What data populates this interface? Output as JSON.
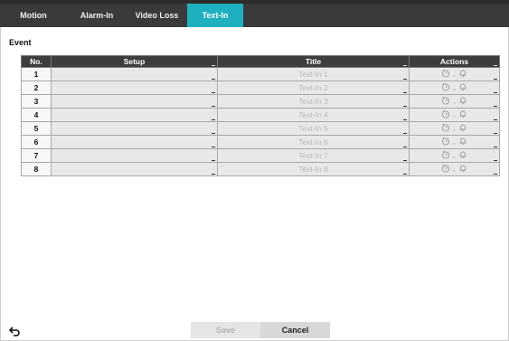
{
  "tabs": [
    {
      "label": "Motion",
      "active": false
    },
    {
      "label": "Alarm-In",
      "active": false
    },
    {
      "label": "Video Loss",
      "active": false
    },
    {
      "label": "Text-In",
      "active": true
    }
  ],
  "section_title": "Event",
  "table": {
    "headers": {
      "no": "No.",
      "setup": "Setup",
      "title": "Title",
      "actions": "Actions"
    },
    "rows": [
      {
        "no": "1",
        "setup": "",
        "title": "Text-In 1",
        "actions": ","
      },
      {
        "no": "2",
        "setup": "",
        "title": "Text-In 2",
        "actions": ","
      },
      {
        "no": "3",
        "setup": "",
        "title": "Text-In 3",
        "actions": ","
      },
      {
        "no": "4",
        "setup": "",
        "title": "Text-In 4",
        "actions": ","
      },
      {
        "no": "5",
        "setup": "",
        "title": "Text-In 5",
        "actions": ","
      },
      {
        "no": "6",
        "setup": "",
        "title": "Text-In 6",
        "actions": ","
      },
      {
        "no": "7",
        "setup": "",
        "title": "Text-In 7",
        "actions": ","
      },
      {
        "no": "8",
        "setup": "",
        "title": "Text-In 8",
        "actions": ","
      }
    ],
    "action_icons": [
      "timer-icon",
      "bell-icon"
    ]
  },
  "footer": {
    "back_icon": "back-arrow-icon",
    "save_label": "Save",
    "cancel_label": "Cancel"
  },
  "colors": {
    "tab_active": "#1fb0c0",
    "tabbar_bg": "#3a3a3a",
    "header_bg": "#3d3d3d",
    "cell_bg": "#e8e8e8"
  }
}
